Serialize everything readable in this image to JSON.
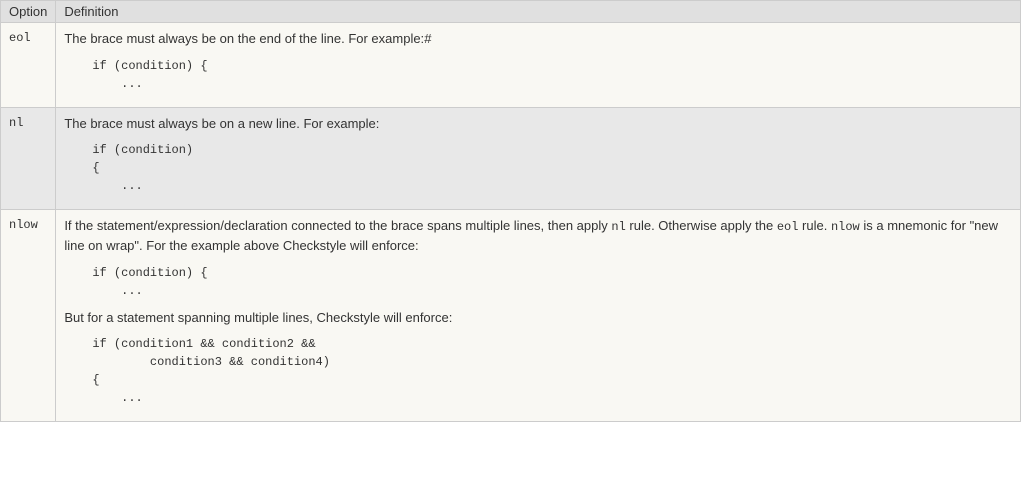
{
  "headers": {
    "option": "Option",
    "definition": "Definition"
  },
  "rows": {
    "eol": {
      "option": "eol",
      "desc": "The brace must always be on the end of the line. For example:",
      "hash": "#",
      "code": "if (condition) {\n    ..."
    },
    "nl": {
      "option": "nl",
      "desc": "The brace must always be on a new line. For example:",
      "code": "if (condition)\n{\n    ..."
    },
    "nlow": {
      "option": "nlow",
      "desc_part1": "If the statement/expression/declaration connected to the brace spans multiple lines, then apply ",
      "code_nl": "nl",
      "desc_part2": " rule. Otherwise apply the ",
      "code_eol": "eol",
      "desc_part3": " rule. ",
      "code_nlow": "nlow",
      "desc_part4": " is a mnemonic for \"new line on wrap\". For the example above Checkstyle will enforce:",
      "code1": "if (condition) {\n    ...",
      "desc_mid": "But for a statement spanning multiple lines, Checkstyle will enforce:",
      "code2": "if (condition1 && condition2 &&\n        condition3 && condition4)\n{\n    ..."
    }
  }
}
